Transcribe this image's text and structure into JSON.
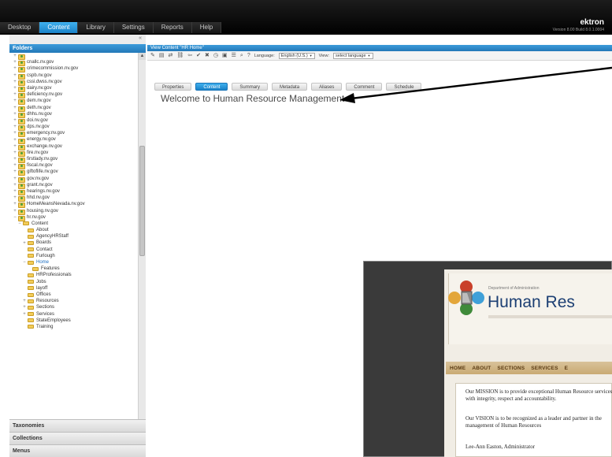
{
  "topnav": {
    "tabs": [
      "Desktop",
      "Content",
      "Library",
      "Settings",
      "Reports",
      "Help"
    ],
    "active": "Content"
  },
  "brand": {
    "name": "ektron",
    "tagline": "Version 8.00 Build 8.0.1.0004"
  },
  "leftpanel": {
    "header": "Folders",
    "tree": [
      {
        "label": "",
        "level": 1,
        "exp": "+"
      },
      {
        "label": "cnallc.nv.gov",
        "level": 1,
        "exp": "+"
      },
      {
        "label": "crimecommission.nv.gov",
        "level": 1,
        "exp": "+"
      },
      {
        "label": "cspb.nv.gov",
        "level": 1,
        "exp": "+"
      },
      {
        "label": "cssi.dwss.nv.gov",
        "level": 1,
        "exp": "+"
      },
      {
        "label": "dairy.nv.gov",
        "level": 1,
        "exp": "+"
      },
      {
        "label": "deficiency.nv.gov",
        "level": 1,
        "exp": "+"
      },
      {
        "label": "dem.nv.gov",
        "level": 1,
        "exp": "+"
      },
      {
        "label": "deth.nv.gov",
        "level": 1,
        "exp": "+"
      },
      {
        "label": "dhhs.nv.gov",
        "level": 1,
        "exp": "+"
      },
      {
        "label": "doi.nv.gov",
        "level": 1,
        "exp": "+"
      },
      {
        "label": "dps.nv.gov",
        "level": 1,
        "exp": "+"
      },
      {
        "label": "emergency.nv.gov",
        "level": 1,
        "exp": "+"
      },
      {
        "label": "energy.nv.gov",
        "level": 1,
        "exp": "+"
      },
      {
        "label": "exchange.nv.gov",
        "level": 1,
        "exp": "+"
      },
      {
        "label": "fire.nv.gov",
        "level": 1,
        "exp": "+"
      },
      {
        "label": "firstlady.nv.gov",
        "level": 1,
        "exp": "+"
      },
      {
        "label": "fiscal.nv.gov",
        "level": 1,
        "exp": "+"
      },
      {
        "label": "giftoflife.nv.gov",
        "level": 1,
        "exp": "+"
      },
      {
        "label": "gov.nv.gov",
        "level": 1,
        "exp": "+"
      },
      {
        "label": "grant.nv.gov",
        "level": 1,
        "exp": "+"
      },
      {
        "label": "hearings.nv.gov",
        "level": 1,
        "exp": "+"
      },
      {
        "label": "hhd.nv.gov",
        "level": 1,
        "exp": "+"
      },
      {
        "label": "HomeMeansNevada.nv.gov",
        "level": 1,
        "exp": "+"
      },
      {
        "label": "housing.nv.gov",
        "level": 1,
        "exp": "+"
      },
      {
        "label": "hr.nv.gov",
        "level": 1,
        "exp": "−"
      },
      {
        "label": "Content",
        "level": 2,
        "exp": "−"
      },
      {
        "label": "About",
        "level": 3,
        "exp": ""
      },
      {
        "label": "AgencyHRStaff",
        "level": 3,
        "exp": ""
      },
      {
        "label": "Boards",
        "level": 3,
        "exp": "+"
      },
      {
        "label": "Contact",
        "level": 3,
        "exp": ""
      },
      {
        "label": "Furlough",
        "level": 3,
        "exp": ""
      },
      {
        "label": "Home",
        "level": 3,
        "exp": "−",
        "selected": true
      },
      {
        "label": "Features",
        "level": 4,
        "exp": ""
      },
      {
        "label": "HRProfessionals",
        "level": 3,
        "exp": ""
      },
      {
        "label": "Jobs",
        "level": 3,
        "exp": ""
      },
      {
        "label": "layoff",
        "level": 3,
        "exp": ""
      },
      {
        "label": "Offices",
        "level": 3,
        "exp": ""
      },
      {
        "label": "Resources",
        "level": 3,
        "exp": "+"
      },
      {
        "label": "Sections",
        "level": 3,
        "exp": "+"
      },
      {
        "label": "Services",
        "level": 3,
        "exp": "+"
      },
      {
        "label": "StateEmployees",
        "level": 3,
        "exp": ""
      },
      {
        "label": "Training",
        "level": 3,
        "exp": ""
      }
    ],
    "sections": [
      "Taxonomies",
      "Collections",
      "Menus"
    ]
  },
  "editor": {
    "title": "View Content \"HR Home\"",
    "toolbar": {
      "language_label": "Language:",
      "language_value": "English (U.S.)",
      "view_label": "View:",
      "view_value": "select language"
    },
    "tabs": [
      "Properties",
      "Content",
      "Summary",
      "Metadata",
      "Aliases",
      "Comment",
      "Schedule"
    ],
    "active_tab": "Content",
    "welcome": "Welcome to Human Resource Management"
  },
  "preview": {
    "dept": "Department of Administration",
    "title": "Human Res",
    "nav": [
      "HOME",
      "ABOUT",
      "SECTIONS",
      "SERVICES",
      "E"
    ],
    "mission": "Our MISSION is to provide exceptional Human Resource services with integrity, respect and accountability.",
    "vision": "Our VISION is to be recognized as a leader and partner in the management of Human Resources",
    "admin": "Lee-Ann Easton, Administrator"
  },
  "colors": {
    "accent": "#2a8ad0",
    "topbar": "#000000",
    "site_nav": "#c9aa73",
    "site_title": "#1c3f73"
  }
}
